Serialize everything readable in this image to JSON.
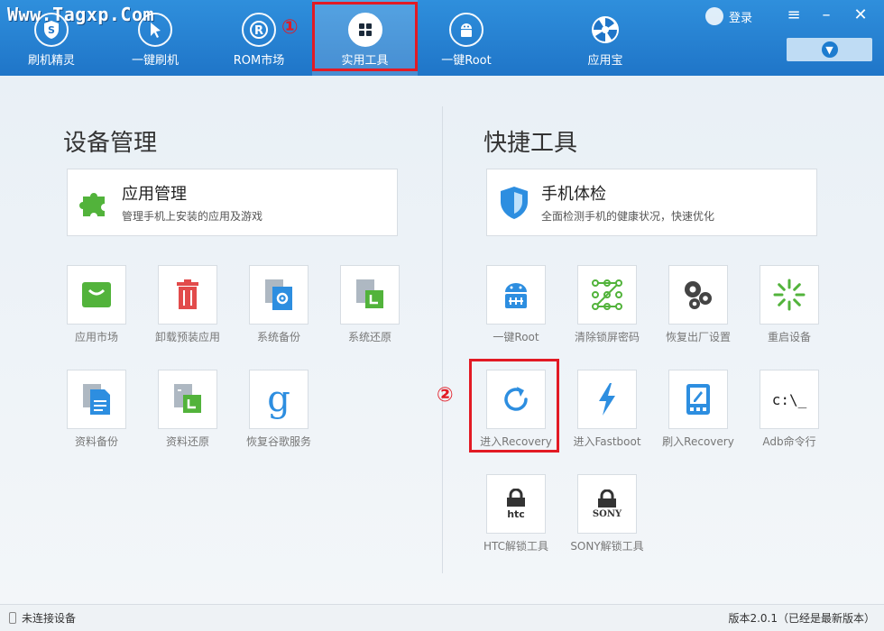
{
  "watermark": "Www.Tagxp.Com",
  "nav": [
    {
      "label": "刷机精灵",
      "icon": "shield-s-icon"
    },
    {
      "label": "一键刷机",
      "icon": "cursor-icon"
    },
    {
      "label": "ROM市场",
      "icon": "rom-r-icon"
    },
    {
      "label": "实用工具",
      "icon": "grid-icon"
    },
    {
      "label": "一键Root",
      "icon": "android-icon"
    },
    {
      "label": "应用宝",
      "icon": "app-treasure-icon"
    }
  ],
  "markers": {
    "one": "①",
    "two": "②"
  },
  "header": {
    "login": "登录",
    "menu": "≡",
    "minimize": "–",
    "close": "✕"
  },
  "sections": {
    "device": "设备管理",
    "tools": "快捷工具"
  },
  "features": {
    "app_manage": {
      "title": "应用管理",
      "desc": "管理手机上安装的应用及游戏"
    },
    "phone_check": {
      "title": "手机体检",
      "desc": "全面检测手机的健康状况，快速优化"
    }
  },
  "device_tiles": [
    {
      "label": "应用市场"
    },
    {
      "label": "卸载预装应用"
    },
    {
      "label": "系统备份"
    },
    {
      "label": "系统还原"
    },
    {
      "label": "资料备份"
    },
    {
      "label": "资料还原"
    },
    {
      "label": "恢复谷歌服务",
      "glyph": "g"
    }
  ],
  "tool_tiles": [
    {
      "label": "一键Root"
    },
    {
      "label": "清除锁屏密码"
    },
    {
      "label": "恢复出厂设置"
    },
    {
      "label": "重启设备"
    },
    {
      "label": "进入Recovery"
    },
    {
      "label": "进入Fastboot"
    },
    {
      "label": "刷入Recovery"
    },
    {
      "label": "Adb命令行",
      "glyph": "c:\\_"
    },
    {
      "label": "HTC解锁工具",
      "glyph": "htc"
    },
    {
      "label": "SONY解锁工具",
      "glyph": "SONY"
    }
  ],
  "status": {
    "device": "未连接设备",
    "version": "版本2.0.1（已经是最新版本）"
  },
  "colors": {
    "brand_blue": "#1f75c8",
    "highlight_red": "#e21a24",
    "accent_green": "#52b33b"
  }
}
